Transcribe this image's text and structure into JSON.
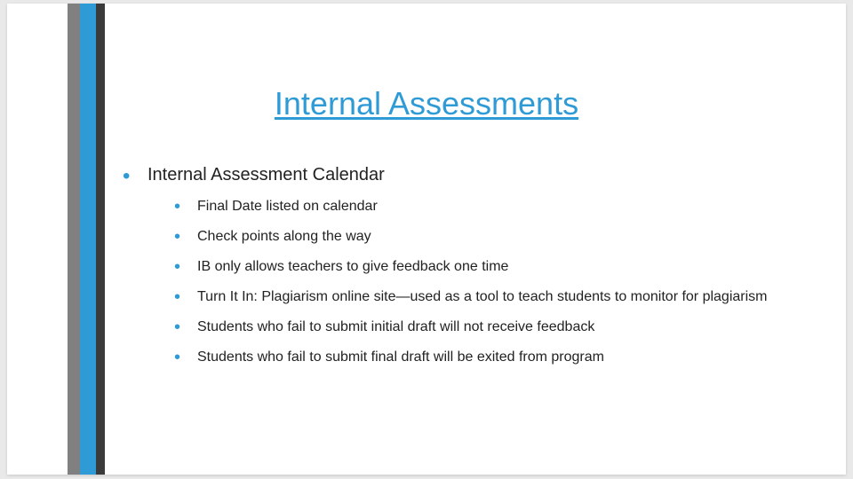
{
  "slide": {
    "title": "Internal Assessments",
    "level1": "Internal Assessment Calendar",
    "level2": [
      "Final Date listed on calendar",
      "Check points along the way",
      "IB only allows teachers to give feedback one time",
      "Turn It In: Plagiarism online site—used as a tool to teach students to monitor for plagiarism",
      "Students who fail to submit initial draft will not receive feedback",
      "Students who fail to submit final draft will be exited from program"
    ]
  }
}
